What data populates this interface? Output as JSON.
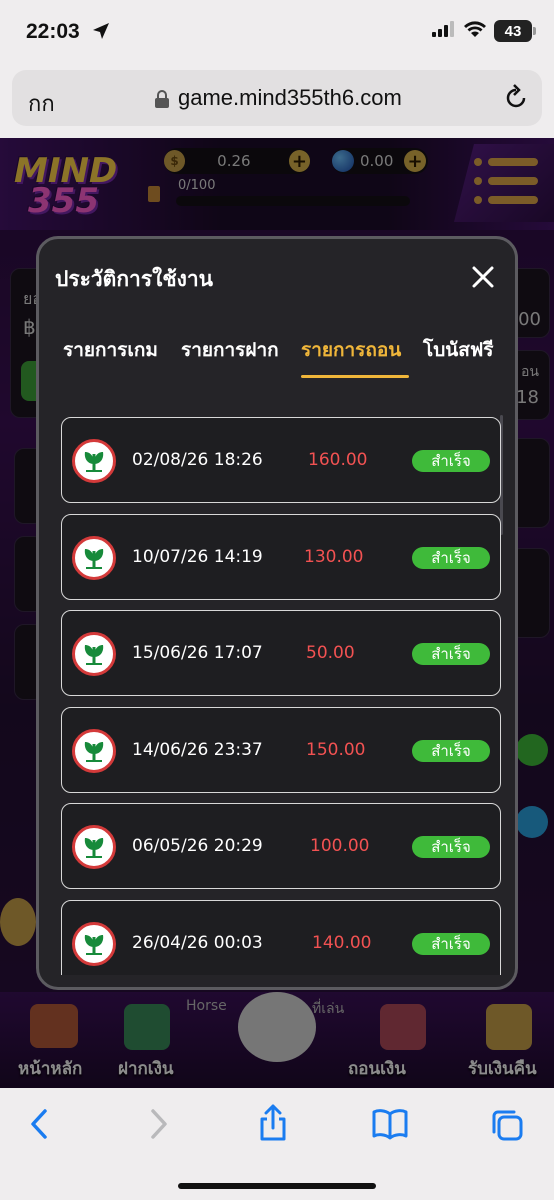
{
  "status_bar": {
    "time": "22:03",
    "battery": "43"
  },
  "browser": {
    "text_size_label": "กก",
    "url": "game.mind355th6.com",
    "toolbar": [
      "back-icon",
      "forward-icon",
      "share-icon",
      "bookmarks-icon",
      "tabs-icon"
    ]
  },
  "game": {
    "logo_line1": "MIND",
    "logo_line2": "355",
    "coin_balance": "0.26",
    "gem_balance": "0.00",
    "level_progress": "0/100",
    "bottom_nav": [
      {
        "label": "หน้าหลัก"
      },
      {
        "label": "ฝากเงิน"
      },
      {
        "label": "ถอนเงิน"
      },
      {
        "label": "รับเงินคืน"
      }
    ],
    "behind_text": {
      "left_frag": "ยอ",
      "baht": "฿",
      "right_frag1": "00",
      "right_frag2": "อน",
      "right_frag3": "18",
      "horse": "Horse",
      "play": "ที่เล่น"
    }
  },
  "modal": {
    "title": "ประวัติการใช้งาน",
    "tabs": [
      {
        "label": "รายการเกม",
        "active": false
      },
      {
        "label": "รายการฝาก",
        "active": false
      },
      {
        "label": "รายการถอน",
        "active": true
      },
      {
        "label": "โบนัสฟรี",
        "active": false
      }
    ],
    "rows": [
      {
        "date": "02/08/26 18:26",
        "amount": "160.00",
        "status": "สำเร็จ"
      },
      {
        "date": "10/07/26 14:19",
        "amount": "130.00",
        "status": "สำเร็จ"
      },
      {
        "date": "15/06/26 17:07",
        "amount": "50.00",
        "status": "สำเร็จ"
      },
      {
        "date": "14/06/26 23:37",
        "amount": "150.00",
        "status": "สำเร็จ"
      },
      {
        "date": "06/05/26 20:29",
        "amount": "100.00",
        "status": "สำเร็จ"
      },
      {
        "date": "26/04/26 00:03",
        "amount": "140.00",
        "status": "สำเร็จ"
      }
    ]
  },
  "colors": {
    "accent": "#f0b63a",
    "amount": "#f25252",
    "success": "#3fba3a"
  }
}
